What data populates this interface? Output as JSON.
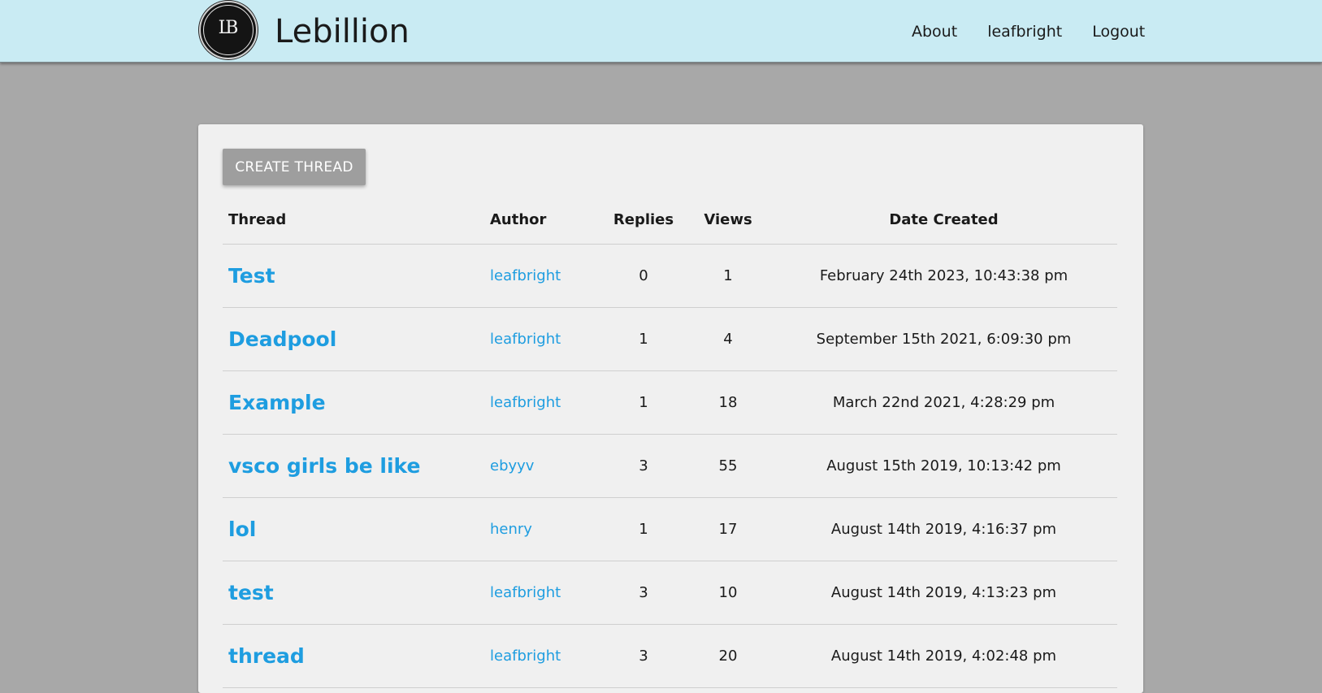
{
  "header": {
    "logo_text": "LB",
    "brand": "Lebillion",
    "nav": [
      {
        "label": "About"
      },
      {
        "label": "leafbright"
      },
      {
        "label": "Logout"
      }
    ]
  },
  "toolbar": {
    "create_label": "CREATE THREAD"
  },
  "table": {
    "columns": {
      "thread": "Thread",
      "author": "Author",
      "replies": "Replies",
      "views": "Views",
      "date": "Date Created"
    },
    "rows": [
      {
        "title": "Test",
        "author": "leafbright",
        "replies": "0",
        "views": "1",
        "date": "February 24th 2023, 10:43:38 pm"
      },
      {
        "title": "Deadpool",
        "author": "leafbright",
        "replies": "1",
        "views": "4",
        "date": "September 15th 2021, 6:09:30 pm"
      },
      {
        "title": "Example",
        "author": "leafbright",
        "replies": "1",
        "views": "18",
        "date": "March 22nd 2021, 4:28:29 pm"
      },
      {
        "title": "vsco girls be like",
        "author": "ebyyv",
        "replies": "3",
        "views": "55",
        "date": "August 15th 2019, 10:13:42 pm"
      },
      {
        "title": "lol",
        "author": "henry",
        "replies": "1",
        "views": "17",
        "date": "August 14th 2019, 4:16:37 pm"
      },
      {
        "title": "test",
        "author": "leafbright",
        "replies": "3",
        "views": "10",
        "date": "August 14th 2019, 4:13:23 pm"
      },
      {
        "title": "thread",
        "author": "leafbright",
        "replies": "3",
        "views": "20",
        "date": "August 14th 2019, 4:02:48 pm"
      }
    ]
  },
  "colors": {
    "navbar_bg": "#c9ebf3",
    "page_bg": "#a8a8a8",
    "card_bg": "#f0f0f0",
    "link": "#1e9de0",
    "button_bg": "#9e9e9e"
  }
}
